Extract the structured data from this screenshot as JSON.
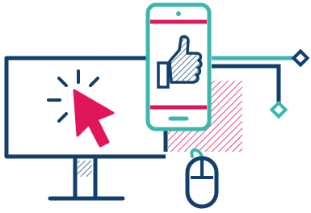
{
  "illustration": {
    "colors": {
      "navy": "#123f6b",
      "teal": "#3cb7ad",
      "pink": "#e0165a",
      "hatch": "#e0165a",
      "background": "#ffffff"
    },
    "icons": [
      "desktop-monitor-icon",
      "cursor-click-icon",
      "smartphone-icon",
      "thumbs-up-icon",
      "computer-mouse-icon",
      "network-node-icon"
    ]
  }
}
